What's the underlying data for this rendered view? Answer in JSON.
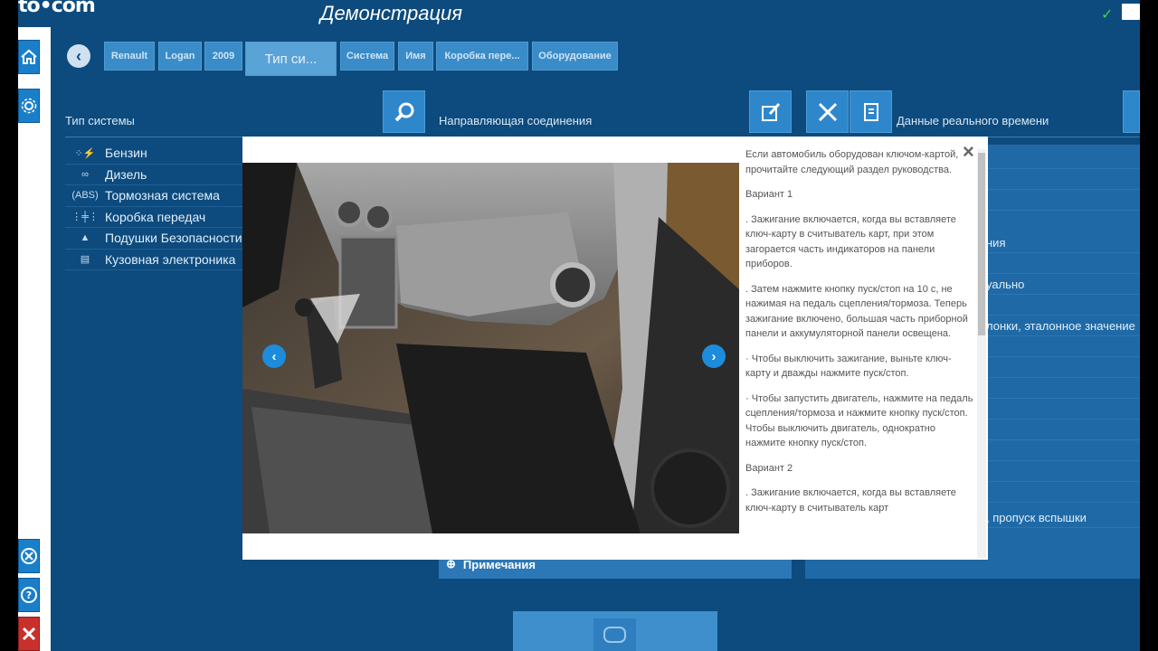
{
  "app": {
    "logo": "to•com",
    "title": "Демонстрация"
  },
  "breadcrumbs": [
    {
      "label": "Renault"
    },
    {
      "label": "Logan"
    },
    {
      "label": "2009"
    },
    {
      "label": "Тип си..."
    },
    {
      "label": "Система"
    },
    {
      "label": "Имя"
    },
    {
      "label": "Коробка пере..."
    },
    {
      "label": "Оборудование"
    }
  ],
  "sections": {
    "system_type": "Тип системы",
    "connection_guide": "Направляющая соединения",
    "live_data": "Данные реального времени"
  },
  "systems": [
    {
      "label": "Бензин",
      "icon": "fuel-injector-icon"
    },
    {
      "label": "Дизель",
      "icon": "glow-plug-icon"
    },
    {
      "label": "Тормозная система",
      "icon": "abs-icon"
    },
    {
      "label": "Коробка передач",
      "icon": "gearbox-icon"
    },
    {
      "label": "Подушки Безопасности",
      "icon": "srs-icon"
    },
    {
      "label": "Кузовная электроника",
      "icon": "body-electronics-icon"
    }
  ],
  "right_panel": {
    "rows": [
      "",
      "",
      "",
      "ния",
      "",
      "уально",
      "",
      "лонки, эталонное значение",
      "",
      "",
      "",
      "",
      "",
      "",
      "",
      "",
      ", пропуск вспышки",
      "",
      ""
    ]
  },
  "notes": {
    "label": "Примечания"
  },
  "modal": {
    "close": "×",
    "paragraphs": [
      "Если автомобиль оборудован ключом-картой, прочитайте следующий раздел руководства.",
      "Вариант 1",
      ". Зажигание включается, когда вы вставляете ключ-карту в считыватель карт, при этом загорается часть индикаторов на панели приборов.",
      ". Затем нажмите кнопку пуск/стоп на 10 с, не нажимая на педаль сцепления/тормоза. Теперь зажигание включено, большая часть приборной панели и аккумуляторной панели освещена.",
      "· Чтобы выключить зажигание, выньте ключ-карту и дважды нажмите пуск/стоп.",
      "· Чтобы запустить двигатель, нажмите на педаль сцепления/тормоза и нажмите кнопку пуск/стоп. Чтобы выключить двигатель, однократно нажмите кнопку пуск/стоп.",
      "Вариант 2",
      ". Зажигание включается, когда вы вставляете ключ-карту в считыватель карт"
    ]
  },
  "colors": {
    "background": "#0d4b7e",
    "accent": "#2f87cb",
    "status_ok": "#3fd14a"
  }
}
